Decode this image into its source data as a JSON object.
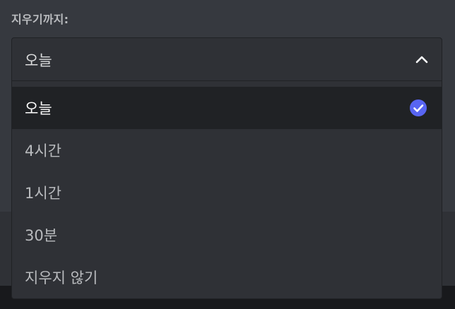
{
  "form": {
    "label": "지우기까지:"
  },
  "select": {
    "value": "오늘",
    "expanded": true
  },
  "options": [
    {
      "label": "오늘",
      "selected": true
    },
    {
      "label": "4시간",
      "selected": false
    },
    {
      "label": "1시간",
      "selected": false
    },
    {
      "label": "30분",
      "selected": false
    },
    {
      "label": "지우지 않기",
      "selected": false
    }
  ],
  "colors": {
    "accent": "#5865f2",
    "panel": "#2f3136",
    "selected_row": "#202225",
    "background": "#36393f"
  }
}
